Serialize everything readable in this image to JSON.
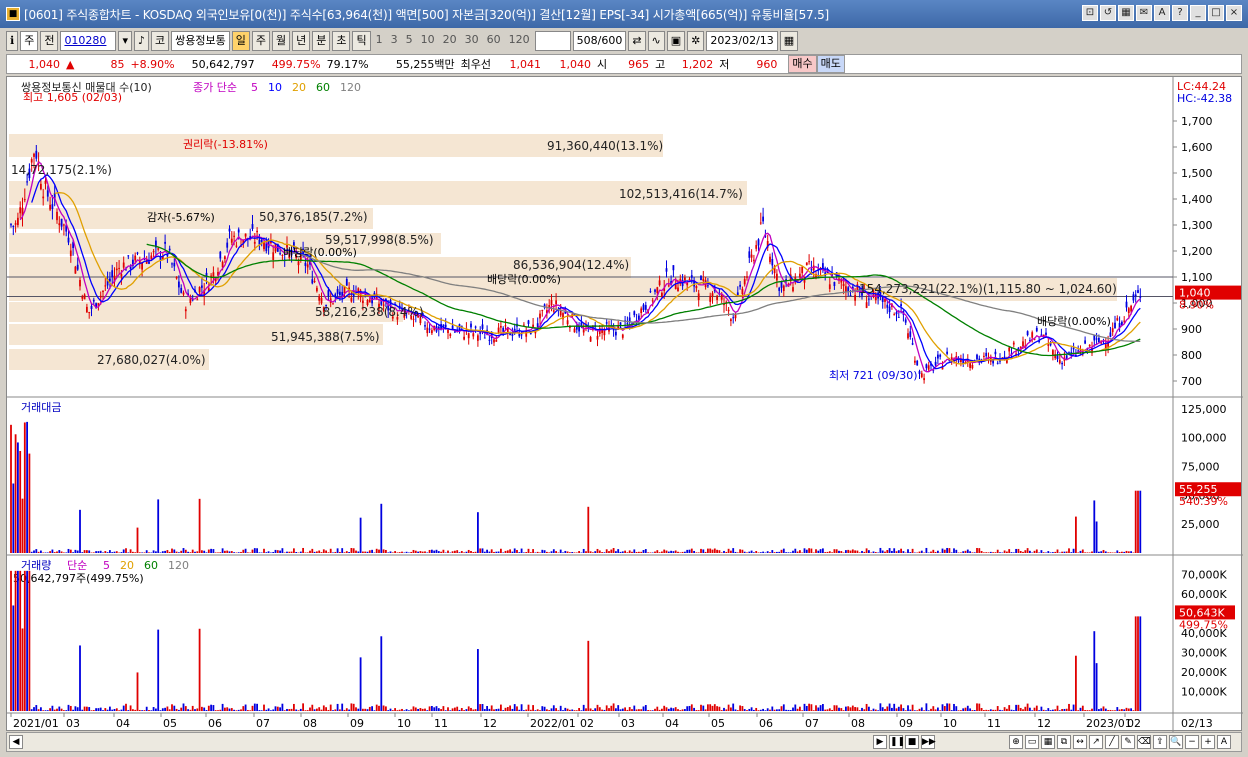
{
  "window": {
    "title": "[0601] 주식종합차트 - KOSDAQ 외국인보유[0(천)] 주식수[63,964(천)] 액면[500] 자본금[320(억)] 결산[12월] EPS[-34] 시가총액[665(억)] 유통비율[57.5]",
    "buttons": [
      "⊡",
      "↺",
      "▦",
      "✉",
      "A",
      "?",
      "_",
      "□",
      "×"
    ]
  },
  "toolbar": {
    "type_select": "주",
    "prev_label": "전",
    "stock_code": "010280",
    "market_label": "코",
    "stock_name": "쌍용정보통",
    "periods": [
      "일",
      "주",
      "월",
      "년",
      "분",
      "초",
      "틱"
    ],
    "active_period": "일",
    "intervals": [
      "1",
      "3",
      "5",
      "10",
      "20",
      "30",
      "60",
      "120"
    ],
    "count": "508",
    "count_max": "/600",
    "date": "2023/02/13"
  },
  "quote": {
    "price": "1,040",
    "arrow": "▲",
    "change": "85",
    "change_pct": "+8.90%",
    "volume": "50,642,797",
    "volume_pct": "499.75%",
    "turnover_pct": "79.17%",
    "amount": "55,255백만",
    "best_label": "최우선",
    "ask": "1,041",
    "bid": "1,040",
    "open_label": "시",
    "open": "965",
    "high_label": "고",
    "high": "1,202",
    "low_label": "저",
    "low": "960",
    "buy_label": "매수",
    "sell_label": "매도"
  },
  "price_panel": {
    "legend_title": "쌍용정보통신 매물대 수(10)",
    "legend_ma_prefix": "종가 단순",
    "legend_ma": [
      {
        "label": "5",
        "color": "#c000c0"
      },
      {
        "label": "10",
        "color": "#0000ff"
      },
      {
        "label": "20",
        "color": "#e0a000"
      },
      {
        "label": "60",
        "color": "#008000"
      },
      {
        "label": "120",
        "color": "#808080"
      }
    ],
    "lc": "LC:44.24",
    "hc": "HC:-42.38",
    "high_mark": "최고 1,605 (02/03)",
    "low_mark": "최저 721 (09/30)",
    "current_price": "1,040",
    "current_pct": "8.90%",
    "y_ticks": [
      "1,700",
      "1,600",
      "1,500",
      "1,400",
      "1,300",
      "1,200",
      "1,100",
      "1,000",
      "900",
      "800",
      "700"
    ],
    "events": [
      {
        "text": "권리락(-13.81%)"
      },
      {
        "text": "감자(-5.67%)"
      },
      {
        "text": "배당락(0.00%)"
      },
      {
        "text": "배당락(0.00%)"
      },
      {
        "text": "배당락(0.00%)"
      }
    ],
    "volume_profile": [
      {
        "text": "91,360,440(13.1%)"
      },
      {
        "text": "14,72,175(2.1%)"
      },
      {
        "text": "102,513,416(14.7%)"
      },
      {
        "text": "50,376,185(7.2%)"
      },
      {
        "text": "59,517,998(8.5%)"
      },
      {
        "text": "86,536,904(12.4%)"
      },
      {
        "text": "154,273,221(22.1%)(1,115.80 ~ 1,024.60)"
      },
      {
        "text": "58,216,238(8.4%)"
      },
      {
        "text": "51,945,388(7.5%)"
      },
      {
        "text": "27,680,027(4.0%)"
      }
    ]
  },
  "amount_panel": {
    "title": "거래대금",
    "y_ticks": [
      "125,000",
      "100,000",
      "75,000",
      "50,000",
      "25,000"
    ],
    "current": "55,255",
    "current_pct": "540.39%"
  },
  "volume_panel": {
    "title": "거래량",
    "ma_prefix": "단순",
    "ma": [
      {
        "label": "5",
        "color": "#c000c0"
      },
      {
        "label": "20",
        "color": "#e0a000"
      },
      {
        "label": "60",
        "color": "#008000"
      },
      {
        "label": "120",
        "color": "#808080"
      }
    ],
    "summary": "50,642,797주(499.75%)",
    "y_ticks": [
      "70,000K",
      "60,000K",
      "50,000K",
      "40,000K",
      "30,000K",
      "20,000K",
      "10,000K"
    ],
    "current": "50,643K",
    "current_pct": "499.75%"
  },
  "x_axis": {
    "labels": [
      "2021/01",
      "03",
      "04",
      "05",
      "06",
      "07",
      "08",
      "09",
      "10",
      "11",
      "12",
      "2022/01",
      "02",
      "03",
      "04",
      "05",
      "06",
      "07",
      "08",
      "09",
      "10",
      "11",
      "12",
      "2023/01",
      "02"
    ],
    "last_date": "02/13"
  },
  "colors": {
    "up": "#e00000",
    "down": "#0000e0",
    "band": "#f5e6d3"
  },
  "chart_data": {
    "type": "candlestick",
    "anchors": [
      [
        "2021/01",
        1300
      ],
      [
        "2021/01",
        1605
      ],
      [
        "2021/02",
        1450
      ],
      [
        "2021/03",
        1250
      ],
      [
        "2021/03",
        960
      ],
      [
        "2021/04",
        1140
      ],
      [
        "2021/05",
        1200
      ],
      [
        "2021/05",
        1000
      ],
      [
        "2021/06",
        1100
      ],
      [
        "2021/06",
        1250
      ],
      [
        "2021/07",
        1250
      ],
      [
        "2021/08",
        1150
      ],
      [
        "2021/08",
        1000
      ],
      [
        "2021/09",
        1050
      ],
      [
        "2021/10",
        960
      ],
      [
        "2021/11",
        900
      ],
      [
        "2021/12",
        880
      ],
      [
        "2022/01",
        900
      ],
      [
        "2022/01",
        1000
      ],
      [
        "2022/02",
        890
      ],
      [
        "2022/03",
        900
      ],
      [
        "2022/04",
        1100
      ],
      [
        "2022/05",
        1050
      ],
      [
        "2022/05",
        950
      ],
      [
        "2022/06",
        1300
      ],
      [
        "2022/06",
        1050
      ],
      [
        "2022/07",
        1130
      ],
      [
        "2022/08",
        1050
      ],
      [
        "2022/09",
        960
      ],
      [
        "2022/09",
        721
      ],
      [
        "2022/10",
        790
      ],
      [
        "2022/11",
        780
      ],
      [
        "2022/12",
        880
      ],
      [
        "2022/12",
        780
      ],
      [
        "2023/01",
        830
      ],
      [
        "2023/01",
        870
      ],
      [
        "2023/02",
        1040
      ]
    ]
  }
}
